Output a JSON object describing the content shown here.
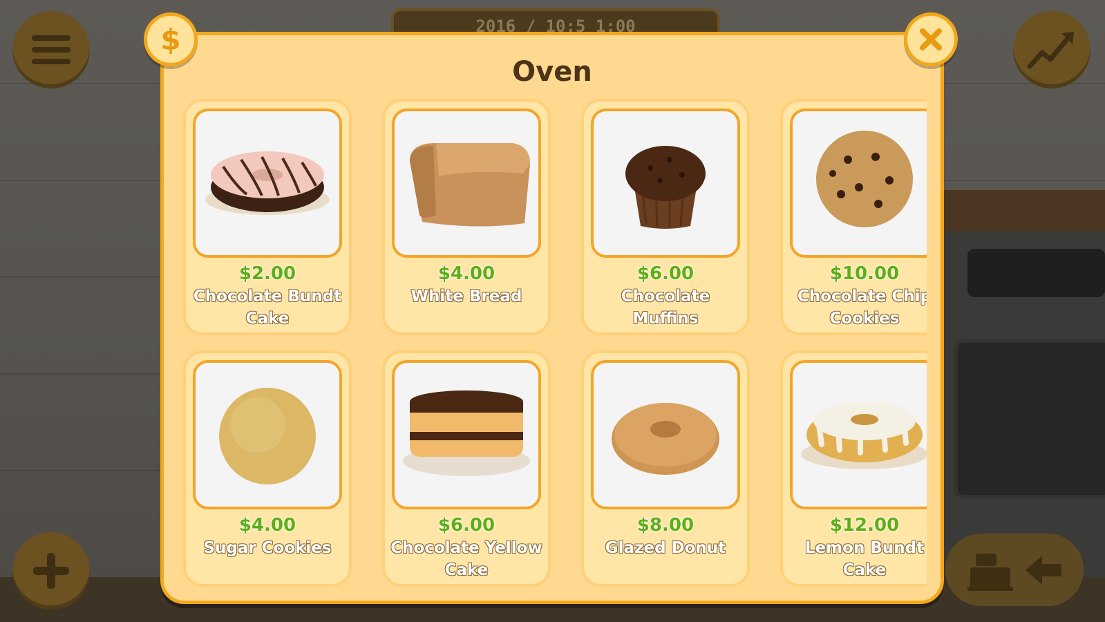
{
  "hud": {
    "time": "2016 / 10:5 1:00",
    "menu_icon": "hamburger-menu-icon",
    "stats_icon": "trend-up-icon",
    "add_icon": "plus-icon",
    "register_icon": "cash-register-icon",
    "back_icon": "arrow-left-icon"
  },
  "modal": {
    "title": "Oven",
    "coin_icon": "dollar-icon",
    "close_icon": "close-icon",
    "accent": "#f2a81d",
    "background": "#ffd98f",
    "price_color": "#5fae16",
    "star_color": "#8a8a8a"
  },
  "products": [
    {
      "name": "Chocolate Bundt Cake",
      "price": "$2.00",
      "icon": "chocolate-bundt-cake-icon",
      "stars": 0
    },
    {
      "name": "White Bread",
      "price": "$4.00",
      "icon": "white-bread-icon",
      "stars": 0
    },
    {
      "name": "Chocolate Muffins",
      "price": "$6.00",
      "icon": "chocolate-muffin-icon",
      "stars": 0
    },
    {
      "name": "Chocolate Chip Cookies",
      "price": "$10.00",
      "icon": "chocolate-chip-cookie-icon",
      "stars": 0
    },
    {
      "name": "Sugar Cookies",
      "price": "$4.00",
      "icon": "sugar-cookie-icon",
      "stars": 0
    },
    {
      "name": "Chocolate Yellow Cake",
      "price": "$6.00",
      "icon": "chocolate-yellow-cake-icon",
      "stars": 0
    },
    {
      "name": "Glazed Donut",
      "price": "$8.00",
      "icon": "glazed-donut-icon",
      "stars": 0
    },
    {
      "name": "Lemon Bundt Cake",
      "price": "$12.00",
      "icon": "lemon-bundt-cake-icon",
      "stars": 0
    }
  ]
}
